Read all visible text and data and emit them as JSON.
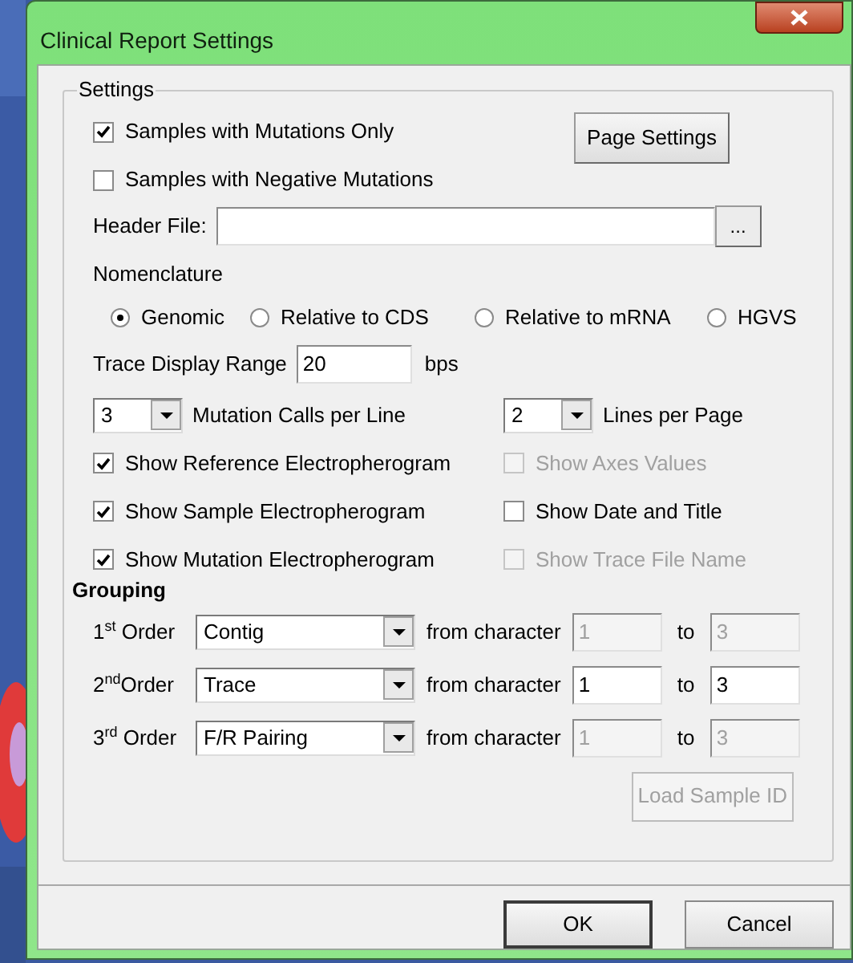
{
  "window": {
    "title": "Clinical Report Settings"
  },
  "settings": {
    "label": "Settings",
    "mutations_only": {
      "label": "Samples with Mutations Only",
      "checked": true
    },
    "negative_mutations": {
      "label": "Samples with Negative Mutations",
      "checked": false
    },
    "page_settings_button": "Page Settings",
    "header_file": {
      "label": "Header File:",
      "browse_button": "..."
    },
    "nomenclature": {
      "label": "Nomenclature",
      "options": [
        {
          "label": "Genomic",
          "selected": true
        },
        {
          "label": "Relative to CDS",
          "selected": false
        },
        {
          "label": "Relative to mRNA",
          "selected": false
        },
        {
          "label": "HGVS",
          "selected": false
        }
      ]
    },
    "trace_range": {
      "label": "Trace Display Range",
      "value": "20",
      "unit": "bps"
    },
    "mutation_calls": {
      "value": "3",
      "label": "Mutation Calls per Line"
    },
    "lines_per_page": {
      "value": "2",
      "label": "Lines per Page"
    },
    "left_checks": [
      {
        "label": "Show Reference Electropherogram",
        "checked": true,
        "disabled": false
      },
      {
        "label": "Show Sample Electropherogram",
        "checked": true,
        "disabled": false
      },
      {
        "label": "Show Mutation Electropherogram",
        "checked": true,
        "disabled": false
      }
    ],
    "right_checks": [
      {
        "label": "Show Axes Values",
        "checked": false,
        "disabled": true
      },
      {
        "label": "Show Date and Title",
        "checked": false,
        "disabled": false
      },
      {
        "label": "Show Trace File Name",
        "checked": false,
        "disabled": true
      }
    ]
  },
  "grouping": {
    "label": "Grouping",
    "orders": [
      {
        "label": "1$^{st}$ Order",
        "value": "Contig",
        "from_label": "from character",
        "from": "1",
        "to_label": "to",
        "to": "3",
        "disabled": true
      },
      {
        "label": "2$^{nd}$Order",
        "value": "Trace",
        "from_label": "from character",
        "from": "1",
        "to_label": "to",
        "to": "3",
        "disabled": false
      },
      {
        "label": "3$^{rd}$ Order",
        "value": "F/R Pairing",
        "from_label": "from character",
        "from": "1",
        "to_label": "to",
        "to": "3",
        "disabled": true
      }
    ],
    "load_button": {
      "label": "Load Sample ID",
      "disabled": true
    }
  },
  "buttons": [
    {
      "label": "OK",
      "default": true
    },
    {
      "label": "Cancel",
      "default": false
    }
  ]
}
